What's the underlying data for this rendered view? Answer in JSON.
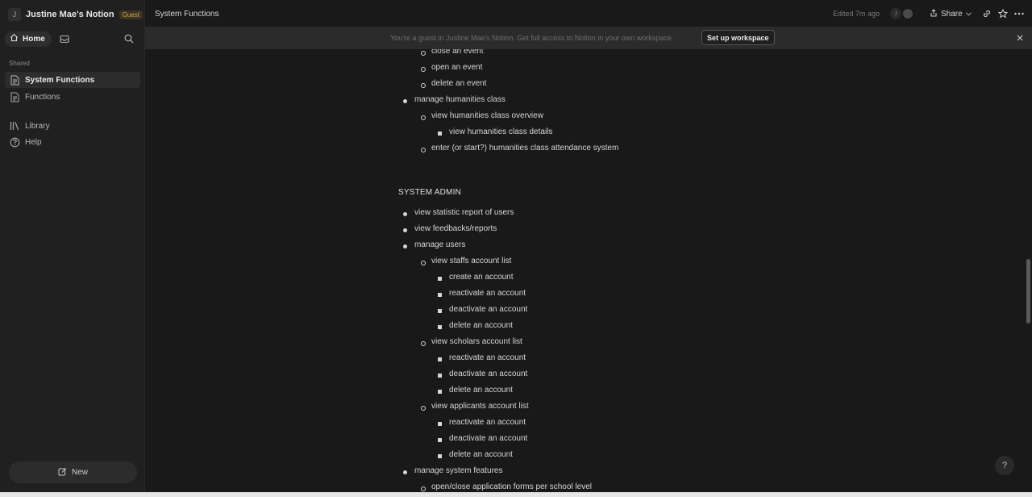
{
  "sidebar": {
    "workspace_initial": "J",
    "workspace_name": "Justine Mae's Notion",
    "guest_badge": "Guest",
    "home_label": "Home",
    "shared_label": "Shared",
    "pages": [
      {
        "label": "System Functions",
        "icon": "page-icon",
        "active": true
      },
      {
        "label": "Functions",
        "icon": "page-icon",
        "active": false
      }
    ],
    "library_label": "Library",
    "help_label": "Help",
    "new_label": "New"
  },
  "topbar": {
    "page_title": "System Functions",
    "edited": "Edited 7m ago",
    "avatar_initial": "J",
    "share_label": "Share"
  },
  "banner": {
    "text": "You're a guest in Justine Mae's Notion. Get full access to Notion in your own workspace.",
    "button_label": "Set up workspace"
  },
  "content": {
    "top_items": [
      {
        "level": 2,
        "text": "close an event"
      },
      {
        "level": 2,
        "text": "open an event"
      },
      {
        "level": 2,
        "text": "delete an event"
      },
      {
        "level": 1,
        "text": "manage humanities class"
      },
      {
        "level": 2,
        "text": "view humanities class overview"
      },
      {
        "level": 3,
        "text": "view humanities class details"
      },
      {
        "level": 2,
        "text": "enter (or start?) humanities class attendance system"
      }
    ],
    "heading": "SYSTEM ADMIN",
    "admin_items": [
      {
        "level": 1,
        "text": "view statistic report of users"
      },
      {
        "level": 1,
        "text": "view feedbacks/reports"
      },
      {
        "level": 1,
        "text": "manage users"
      },
      {
        "level": 2,
        "text": "view staffs account list"
      },
      {
        "level": 3,
        "text": "create an account"
      },
      {
        "level": 3,
        "text": "reactivate an account"
      },
      {
        "level": 3,
        "text": "deactivate an account"
      },
      {
        "level": 3,
        "text": "delete an account"
      },
      {
        "level": 2,
        "text": "view scholars account list"
      },
      {
        "level": 3,
        "text": "reactivate an account"
      },
      {
        "level": 3,
        "text": "deactivate an account"
      },
      {
        "level": 3,
        "text": "delete an account"
      },
      {
        "level": 2,
        "text": "view applicants account list"
      },
      {
        "level": 3,
        "text": "reactivate an account"
      },
      {
        "level": 3,
        "text": "deactivate an account"
      },
      {
        "level": 3,
        "text": "delete an account"
      },
      {
        "level": 1,
        "text": "manage system features"
      },
      {
        "level": 2,
        "text": "open/close application forms per school level"
      }
    ]
  },
  "help_fab": "?"
}
